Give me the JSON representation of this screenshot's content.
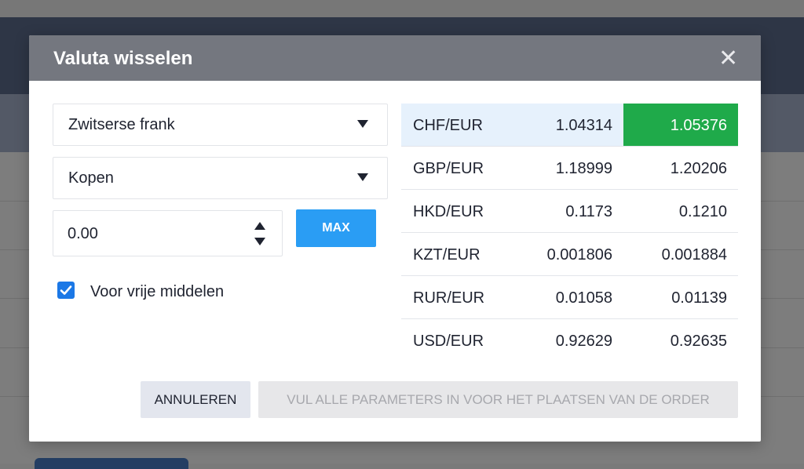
{
  "dialog": {
    "title": "Valuta wisselen",
    "close_icon": "close-icon"
  },
  "form": {
    "currency_select": {
      "value": "Zwitserse frank"
    },
    "side_select": {
      "value": "Kopen"
    },
    "amount": {
      "value": "0.00"
    },
    "max_label": "MAX",
    "free_funds": {
      "label": "Voor vrije middelen",
      "checked": true
    }
  },
  "rates": [
    {
      "pair": "CHF/EUR",
      "bid": "1.04314",
      "ask": "1.05376",
      "selected": true
    },
    {
      "pair": "GBP/EUR",
      "bid": "1.18999",
      "ask": "1.20206"
    },
    {
      "pair": "HKD/EUR",
      "bid": "0.1173",
      "ask": "0.1210"
    },
    {
      "pair": "KZT/EUR",
      "bid": "0.001806",
      "ask": "0.001884"
    },
    {
      "pair": "RUR/EUR",
      "bid": "0.01058",
      "ask": "0.01139"
    },
    {
      "pair": "USD/EUR",
      "bid": "0.92629",
      "ask": "0.92635"
    }
  ],
  "footer": {
    "cancel_label": "ANNULEREN",
    "submit_label": "VUL ALLE PARAMETERS IN VOOR HET PLAATSEN VAN DE ORDER"
  },
  "colors": {
    "header": "#74777f",
    "primary": "#2a9df4",
    "highlight": "#1faa4a",
    "selected_row": "#e6f1fc"
  }
}
